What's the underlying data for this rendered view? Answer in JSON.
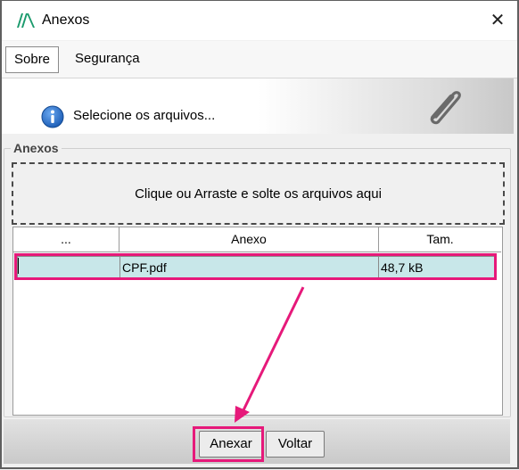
{
  "window": {
    "title": "Anexos",
    "close_glyph": "✕"
  },
  "menu": {
    "items": [
      {
        "label": "Sobre"
      },
      {
        "label": "Segurança"
      }
    ]
  },
  "banner": {
    "text": "Selecione os arquivos...",
    "info_icon": "info-icon",
    "clip_icon": "paperclip-icon"
  },
  "group": {
    "label": "Anexos"
  },
  "dropzone": {
    "text": "Clique ou Arraste e solte os arquivos aqui"
  },
  "grid": {
    "columns": [
      "...",
      "Anexo",
      "Tam."
    ],
    "rows": [
      {
        "c0": "",
        "name": "CPF.pdf",
        "size": "48,7 kB"
      }
    ]
  },
  "footer": {
    "anexar_label": "Anexar",
    "voltar_label": "Voltar"
  },
  "colors": {
    "highlight": "#e6197a",
    "row_selected": "#c8e7e9",
    "info_blue": "#1e5fb8"
  }
}
